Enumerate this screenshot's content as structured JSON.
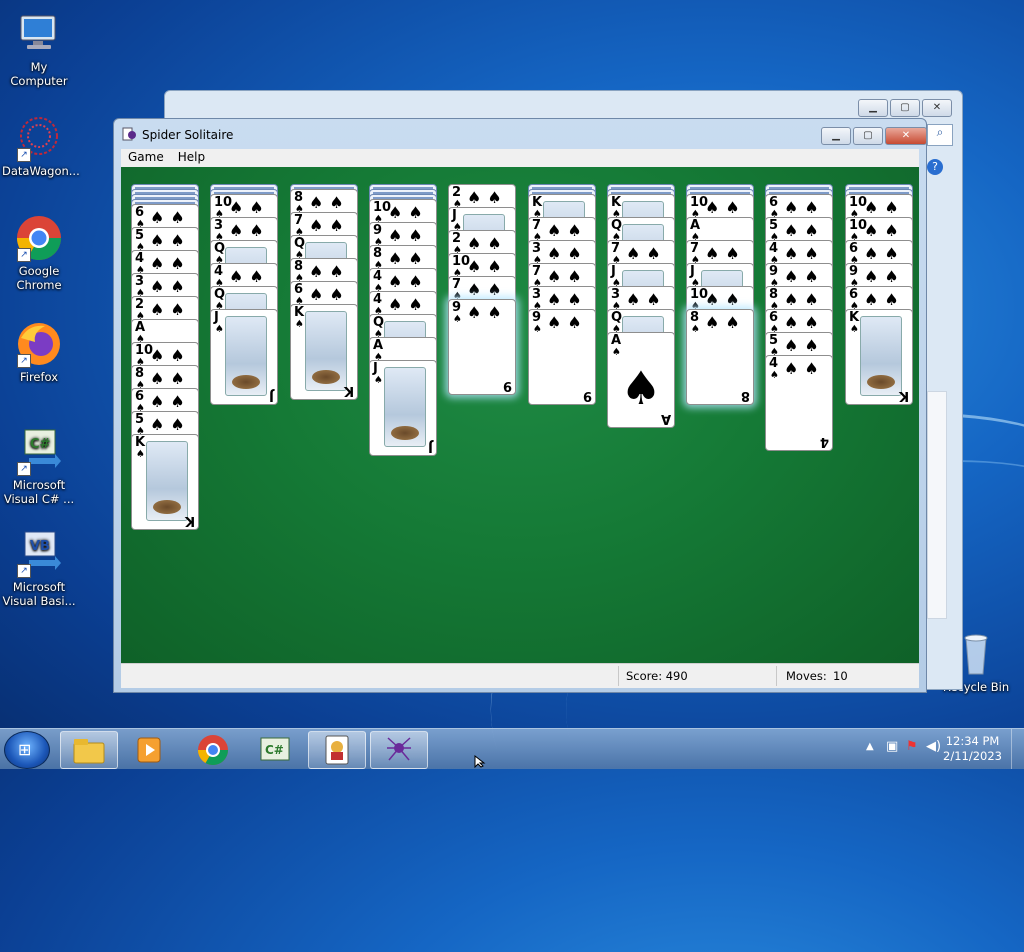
{
  "desktop": {
    "icons": [
      {
        "label": "My Computer",
        "icon": "computer-icon"
      },
      {
        "label": "DataWagon...",
        "icon": "datawagon-icon"
      },
      {
        "label": "Google Chrome",
        "icon": "chrome-icon"
      },
      {
        "label": "Firefox",
        "icon": "firefox-icon"
      },
      {
        "label": "Microsoft Visual C# ...",
        "icon": "visual-csharp-icon",
        "badge": "C#"
      },
      {
        "label": "Microsoft Visual Basi...",
        "icon": "visual-basic-icon",
        "badge": "VB"
      }
    ],
    "recycle_bin": "Recycle Bin"
  },
  "window": {
    "title": "Spider Solitaire",
    "menu": [
      "Game",
      "Help"
    ],
    "score_label": "Score: 490",
    "moves_label": "Moves:",
    "moves_value": "10"
  },
  "tableau": [
    {
      "down": 4,
      "up": [
        "6",
        "5",
        "4",
        "3",
        "2",
        "A",
        "10",
        "8",
        "6",
        "5",
        "K"
      ]
    },
    {
      "down": 2,
      "up": [
        "10",
        "3",
        "Q",
        "4",
        "Q",
        "J"
      ]
    },
    {
      "down": 1,
      "up": [
        "8",
        "7",
        "Q",
        "8",
        "6",
        "K"
      ]
    },
    {
      "down": 3,
      "up": [
        "10",
        "9",
        "8",
        "4",
        "4",
        "Q",
        "A",
        "J"
      ]
    },
    {
      "down": 0,
      "up": [
        "2",
        "J",
        "2",
        "10",
        "7",
        "9"
      ]
    },
    {
      "down": 2,
      "up": [
        "K",
        "7",
        "3",
        "7",
        "3",
        "9"
      ]
    },
    {
      "down": 2,
      "up": [
        "K",
        "Q",
        "7",
        "J",
        "3",
        "Q",
        "A"
      ]
    },
    {
      "down": 2,
      "up": [
        "10",
        "A",
        "7",
        "J",
        "10",
        "8"
      ]
    },
    {
      "down": 2,
      "up": [
        "6",
        "5",
        "4",
        "9",
        "8",
        "6",
        "5",
        "4"
      ]
    },
    {
      "down": 2,
      "up": [
        "10",
        "10",
        "6",
        "9",
        "6",
        "K"
      ]
    }
  ],
  "suit_glyph": "♠",
  "taskbar": {
    "start_glyph": "⊞",
    "apps": [
      "explorer-icon",
      "media-player-icon",
      "chrome-icon",
      "visual-csharp-icon",
      "solitaire-icon",
      "spider-solitaire-icon"
    ],
    "time": "12:34 PM",
    "date": "2/11/2023"
  }
}
